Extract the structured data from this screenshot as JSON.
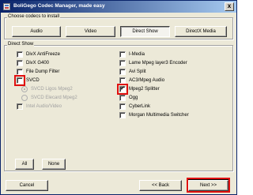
{
  "window": {
    "title": "BoliGego Codec Manager, made easy",
    "close_label": "x"
  },
  "group_choose": {
    "label": "Choose codecs to install",
    "tabs": [
      {
        "label": "Audio",
        "selected": false
      },
      {
        "label": "Video",
        "selected": false
      },
      {
        "label": "Direct Show",
        "selected": true
      },
      {
        "label": "DirectX Media",
        "selected": false
      }
    ]
  },
  "group_direct_show": {
    "label": "Direct Show",
    "left_items": [
      {
        "label": "DivX AntiFreeze",
        "checked": false
      },
      {
        "label": "DivX G400",
        "checked": false
      },
      {
        "label": "File Dump Filter",
        "checked": false
      },
      {
        "label": "SVCD",
        "checked": false
      },
      {
        "label": "SVCD Ligos Mpeg2",
        "radio": true,
        "selected": true,
        "disabled": true
      },
      {
        "label": "SVCD Elecard Mpeg2",
        "radio": true,
        "selected": false,
        "disabled": true
      },
      {
        "label": "Intel Audio/Video",
        "checked": false,
        "disabled": true
      }
    ],
    "right_items": [
      {
        "label": "I-Media",
        "checked": false
      },
      {
        "label": "Lame Mpeg layer3 Encoder",
        "checked": false
      },
      {
        "label": "Avi Split",
        "checked": false
      },
      {
        "label": "AC3/Mpeg Audio",
        "checked": false
      },
      {
        "label": "Mpeg2 Splitter",
        "checked": true
      },
      {
        "label": "Ogg",
        "checked": false
      },
      {
        "label": "CyberLink",
        "checked": false
      },
      {
        "label": "Morgan Multimedia Switcher",
        "checked": false
      }
    ],
    "all_label": "All",
    "none_label": "None"
  },
  "footer": {
    "cancel_label": "Cancel",
    "back_label": "<< Back",
    "next_label": "Next >>"
  }
}
